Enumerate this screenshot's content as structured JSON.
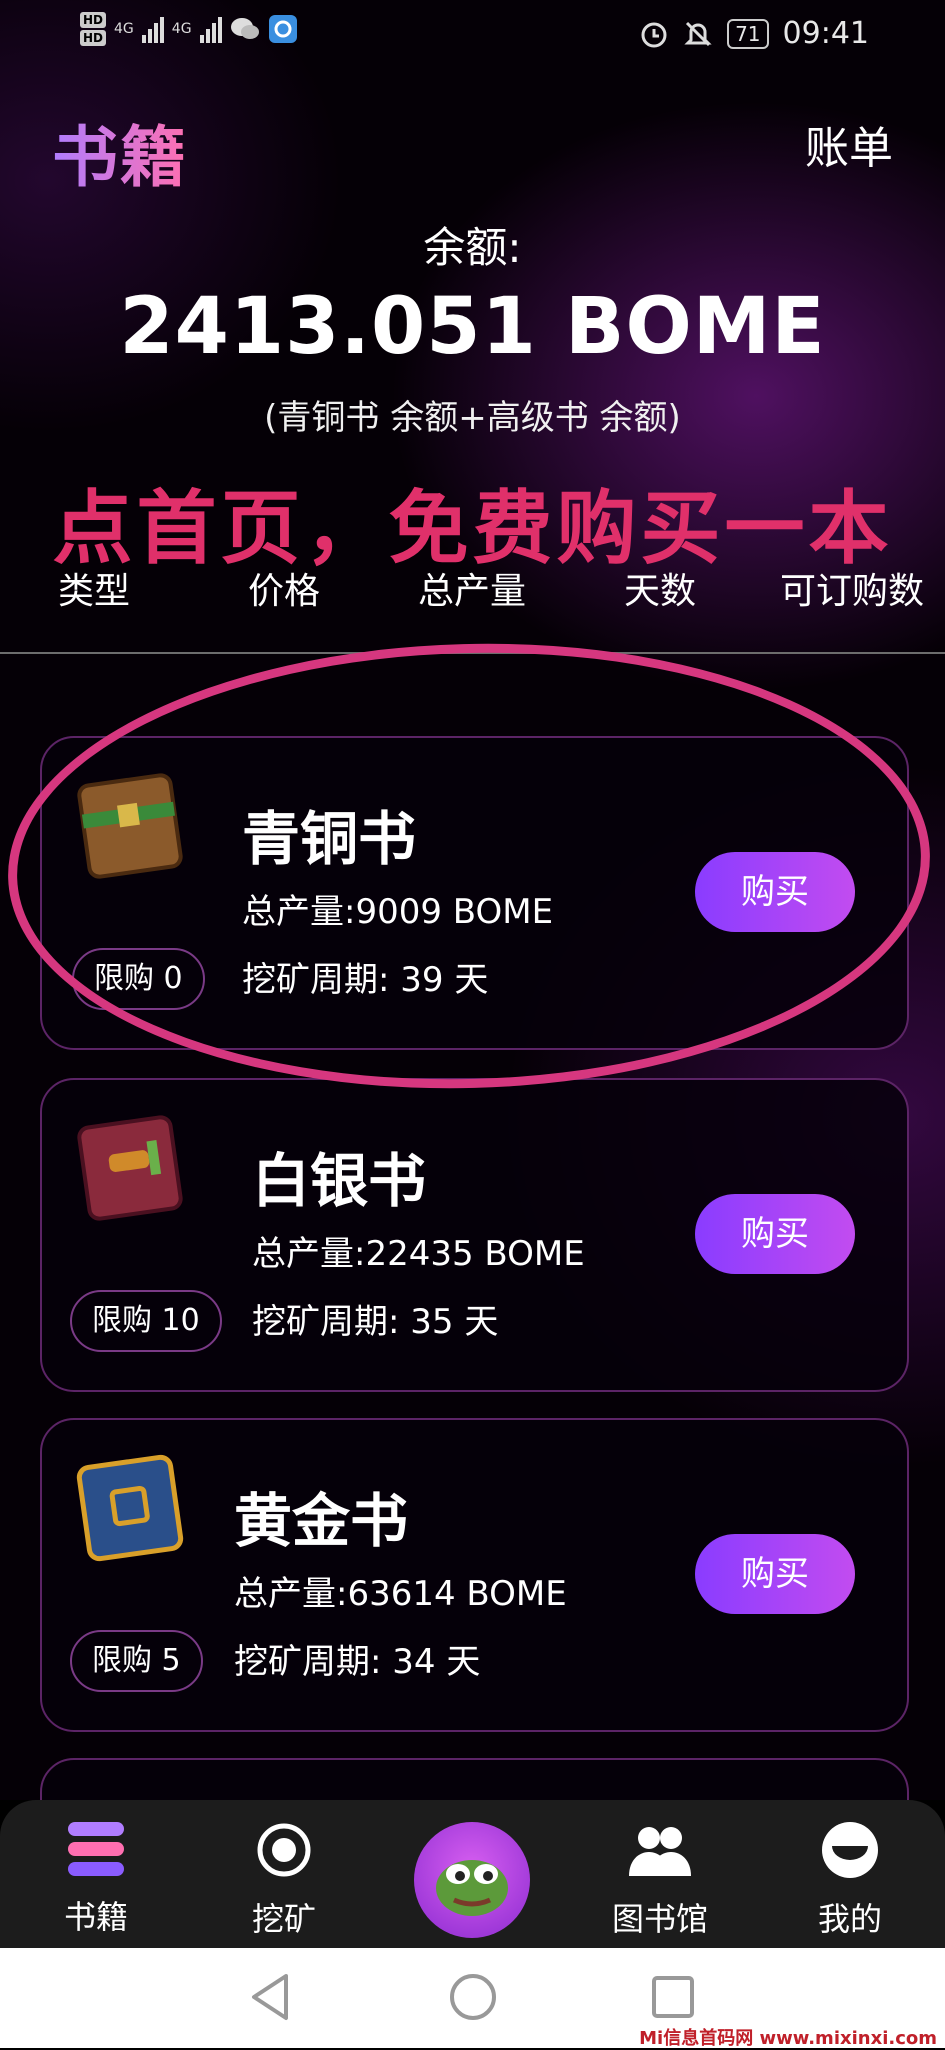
{
  "status_bar": {
    "hd1": "HD",
    "hd2": "HD",
    "net1": "4G",
    "net2": "4G",
    "battery": "71",
    "time": "09:41"
  },
  "header": {
    "title": "书籍",
    "bill_label": "账单",
    "balance_label": "余额:",
    "balance_value": "2413.051 BOME",
    "balance_note": "(青铜书 余额+高级书 余额)",
    "promo": "点首页，免费购买一本"
  },
  "columns": [
    "类型",
    "价格",
    "总产量",
    "天数",
    "可订购数"
  ],
  "books": [
    {
      "name": "青铜书",
      "output": "总产量:9009 BOME",
      "period": "挖矿周期: 39 天",
      "limit": "限购 0",
      "buy_label": "购买",
      "color": "#8b5a2b",
      "accent": "#3a8a3a"
    },
    {
      "name": "白银书",
      "output": "总产量:22435 BOME",
      "period": "挖矿周期: 35 天",
      "limit": "限购 10",
      "buy_label": "购买",
      "color": "#8a2a3c",
      "accent": "#d08a2a"
    },
    {
      "name": "黄金书",
      "output": "总产量:63614 BOME",
      "period": "挖矿周期: 34 天",
      "limit": "限购 5",
      "buy_label": "购买",
      "color": "#2a4f8a",
      "accent": "#d9a02a"
    }
  ],
  "bottom_nav": {
    "items": [
      {
        "label": "书籍",
        "icon": "books-icon"
      },
      {
        "label": "挖矿",
        "icon": "mining-icon"
      },
      {
        "label": "",
        "icon": "frog-avatar-icon"
      },
      {
        "label": "图书馆",
        "icon": "library-icon"
      },
      {
        "label": "我的",
        "icon": "profile-icon"
      }
    ]
  },
  "watermark": "Mi信息首码网 www.mixinxi.com",
  "colors": {
    "accent_purple": "#8a3cff",
    "highlight_pink": "#d6377f",
    "promo_red": "#e0306a"
  }
}
